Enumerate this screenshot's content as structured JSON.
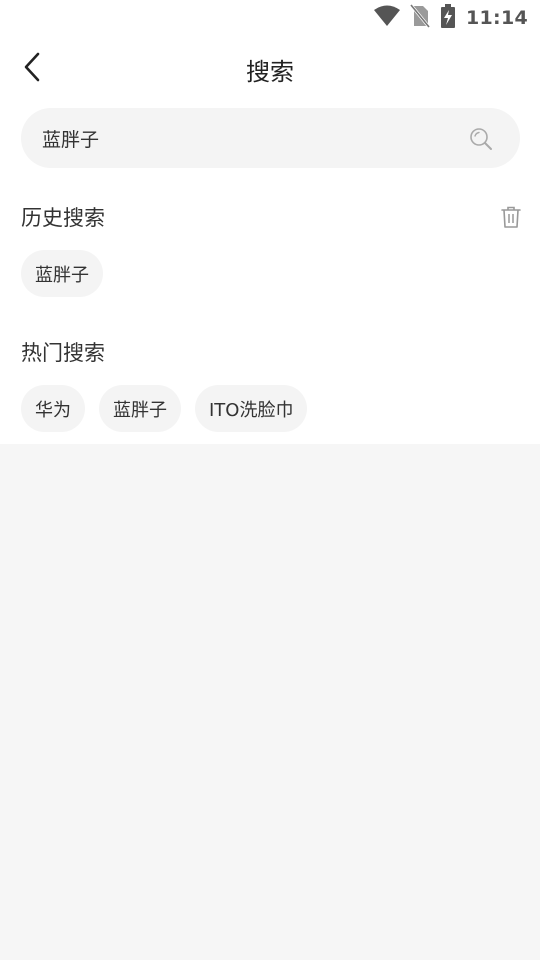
{
  "status_bar": {
    "time": "11:14",
    "icons": [
      "wifi-icon",
      "no-sim-icon",
      "battery-charging-icon"
    ]
  },
  "header": {
    "back_icon": "chevron-left-icon",
    "title": "搜索"
  },
  "search": {
    "value": "蓝胖子",
    "icon": "search-icon"
  },
  "history": {
    "title": "历史搜索",
    "clear_icon": "trash-icon",
    "items": [
      "蓝胖子"
    ]
  },
  "hot": {
    "title": "热门搜索",
    "items": [
      "华为",
      "蓝胖子",
      "ITO洗脸巾"
    ]
  },
  "colors": {
    "background": "#f6f6f6",
    "panel": "#ffffff",
    "chip": "#f4f4f4",
    "text": "#333333",
    "icon_gray": "#999999"
  }
}
